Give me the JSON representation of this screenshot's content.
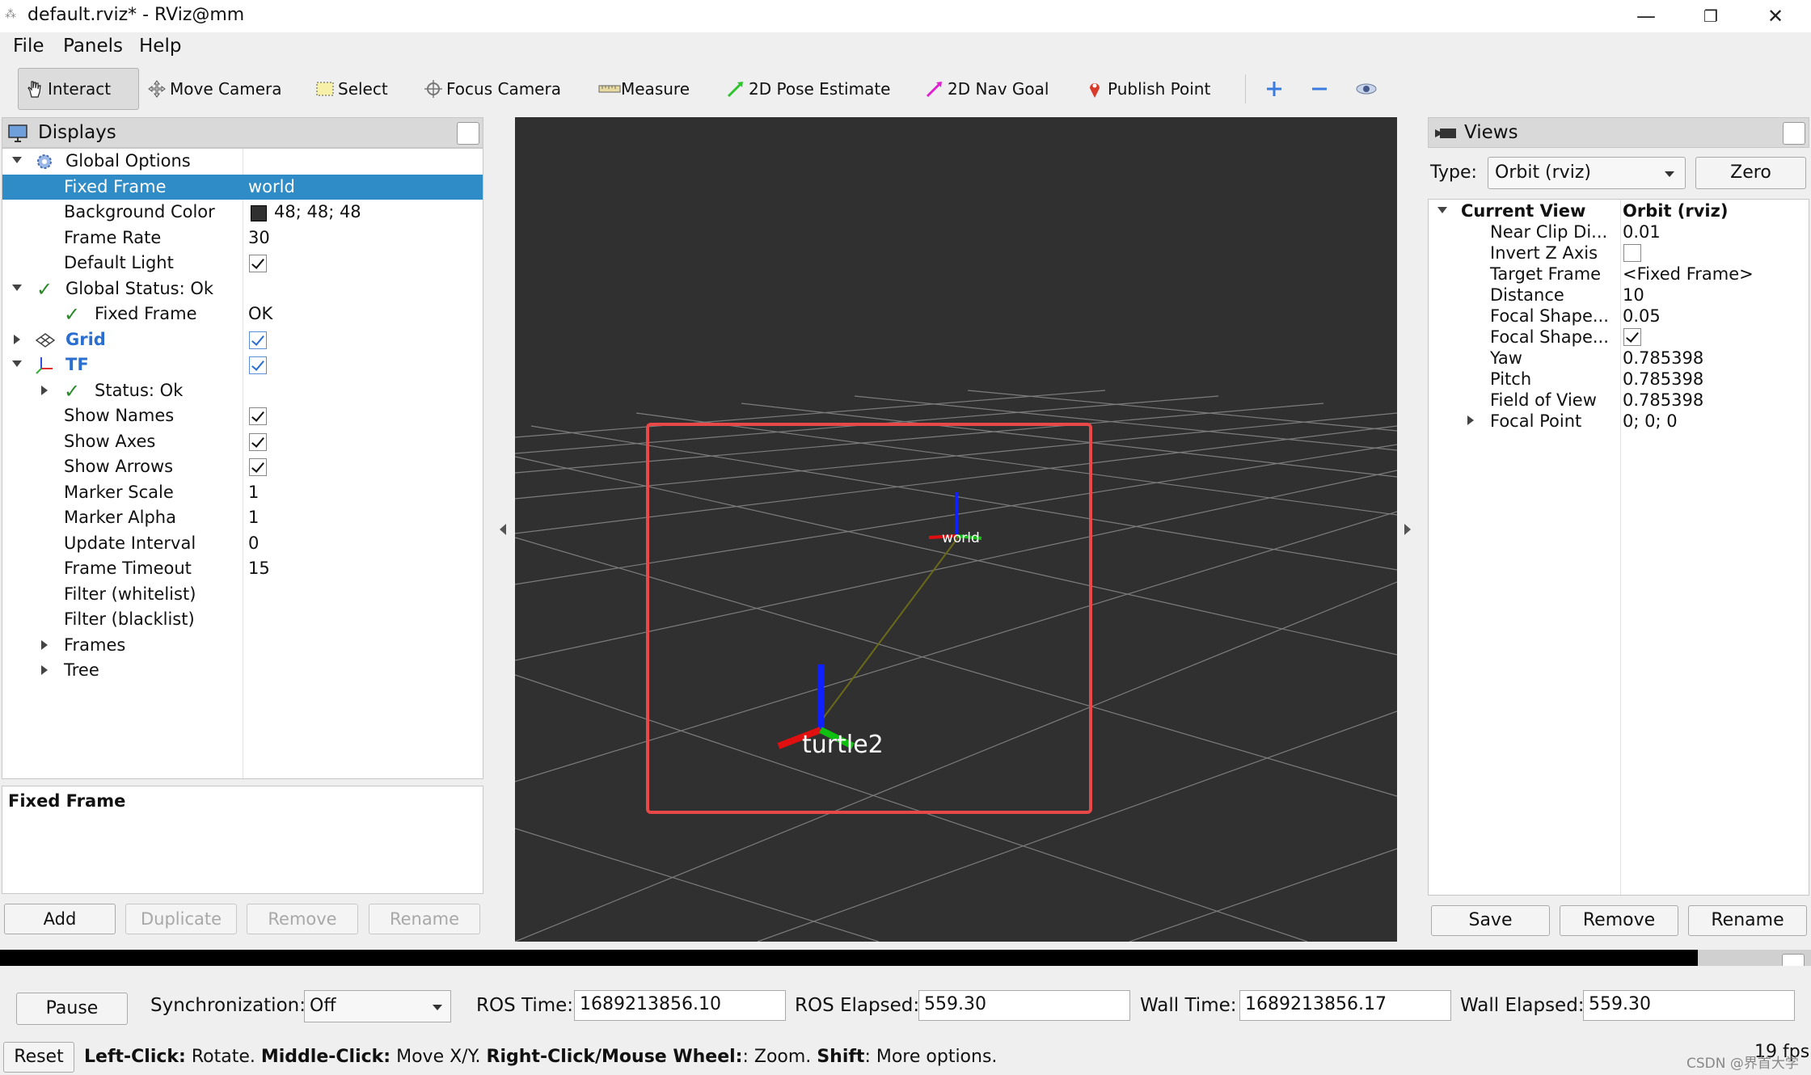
{
  "window": {
    "title": "default.rviz* - RViz@mm",
    "minimize": "—",
    "restore": "❐",
    "close": "✕"
  },
  "menu": {
    "file": "File",
    "panels": "Panels",
    "help": "Help"
  },
  "toolbar": {
    "interact": "Interact",
    "move_camera": "Move Camera",
    "select": "Select",
    "focus_camera": "Focus Camera",
    "measure": "Measure",
    "pose_estimate": "2D Pose Estimate",
    "nav_goal": "2D Nav Goal",
    "publish_point": "Publish Point"
  },
  "displays": {
    "title": "Displays",
    "rows": [
      {
        "label": "Global Options",
        "value": ""
      },
      {
        "label": "Fixed Frame",
        "value": "world"
      },
      {
        "label": "Background Color",
        "value": "48; 48; 48"
      },
      {
        "label": "Frame Rate",
        "value": "30"
      },
      {
        "label": "Default Light",
        "value": ""
      },
      {
        "label": "Global Status: Ok",
        "value": ""
      },
      {
        "label": "Fixed Frame",
        "value": "OK"
      },
      {
        "label": "Grid",
        "value": ""
      },
      {
        "label": "TF",
        "value": ""
      },
      {
        "label": "Status: Ok",
        "value": ""
      },
      {
        "label": "Show Names",
        "value": ""
      },
      {
        "label": "Show Axes",
        "value": ""
      },
      {
        "label": "Show Arrows",
        "value": ""
      },
      {
        "label": "Marker Scale",
        "value": "1"
      },
      {
        "label": "Marker Alpha",
        "value": "1"
      },
      {
        "label": "Update Interval",
        "value": "0"
      },
      {
        "label": "Frame Timeout",
        "value": "15"
      },
      {
        "label": "Filter (whitelist)",
        "value": ""
      },
      {
        "label": "Filter (blacklist)",
        "value": ""
      },
      {
        "label": "Frames",
        "value": ""
      },
      {
        "label": "Tree",
        "value": ""
      }
    ],
    "description_title": "Fixed Frame",
    "buttons": {
      "add": "Add",
      "duplicate": "Duplicate",
      "remove": "Remove",
      "rename": "Rename"
    }
  },
  "scene": {
    "background_color": "#303030",
    "frame_world": "world",
    "frame_turtle": "turtle2"
  },
  "views": {
    "title": "Views",
    "type_label": "Type:",
    "type_value": "Orbit (rviz)",
    "zero": "Zero",
    "rows": [
      {
        "label": "Current View",
        "value": "Orbit (rviz)"
      },
      {
        "label": "Near Clip Di...",
        "value": "0.01"
      },
      {
        "label": "Invert Z Axis",
        "value": ""
      },
      {
        "label": "Target Frame",
        "value": "<Fixed Frame>"
      },
      {
        "label": "Distance",
        "value": "10"
      },
      {
        "label": "Focal Shape...",
        "value": "0.05"
      },
      {
        "label": "Focal Shape...",
        "value": ""
      },
      {
        "label": "Yaw",
        "value": "0.785398"
      },
      {
        "label": "Pitch",
        "value": "0.785398"
      },
      {
        "label": "Field of View",
        "value": "0.785398"
      },
      {
        "label": "Focal Point",
        "value": "0; 0; 0"
      }
    ],
    "buttons": {
      "save": "Save",
      "remove": "Remove",
      "rename": "Rename"
    }
  },
  "time": {
    "pause": "Pause",
    "sync_label": "Synchronization:",
    "sync_value": "Off",
    "ros_time_label": "ROS Time:",
    "ros_time": "1689213856.10",
    "ros_elapsed_label": "ROS Elapsed:",
    "ros_elapsed": "559.30",
    "wall_time_label": "Wall Time:",
    "wall_time": "1689213856.17",
    "wall_elapsed_label": "Wall Elapsed:",
    "wall_elapsed": "559.30"
  },
  "status": {
    "reset": "Reset",
    "lc": "Left-Click:",
    "lc_t": " Rotate. ",
    "mc": "Middle-Click:",
    "mc_t": " Move X/Y. ",
    "rc": "Right-Click/Mouse Wheel:",
    "rc_t": ": Zoom. ",
    "sh": "Shift",
    "sh_t": ": More options.",
    "fps": "19 fps",
    "watermark": "CSDN @界首大学"
  }
}
